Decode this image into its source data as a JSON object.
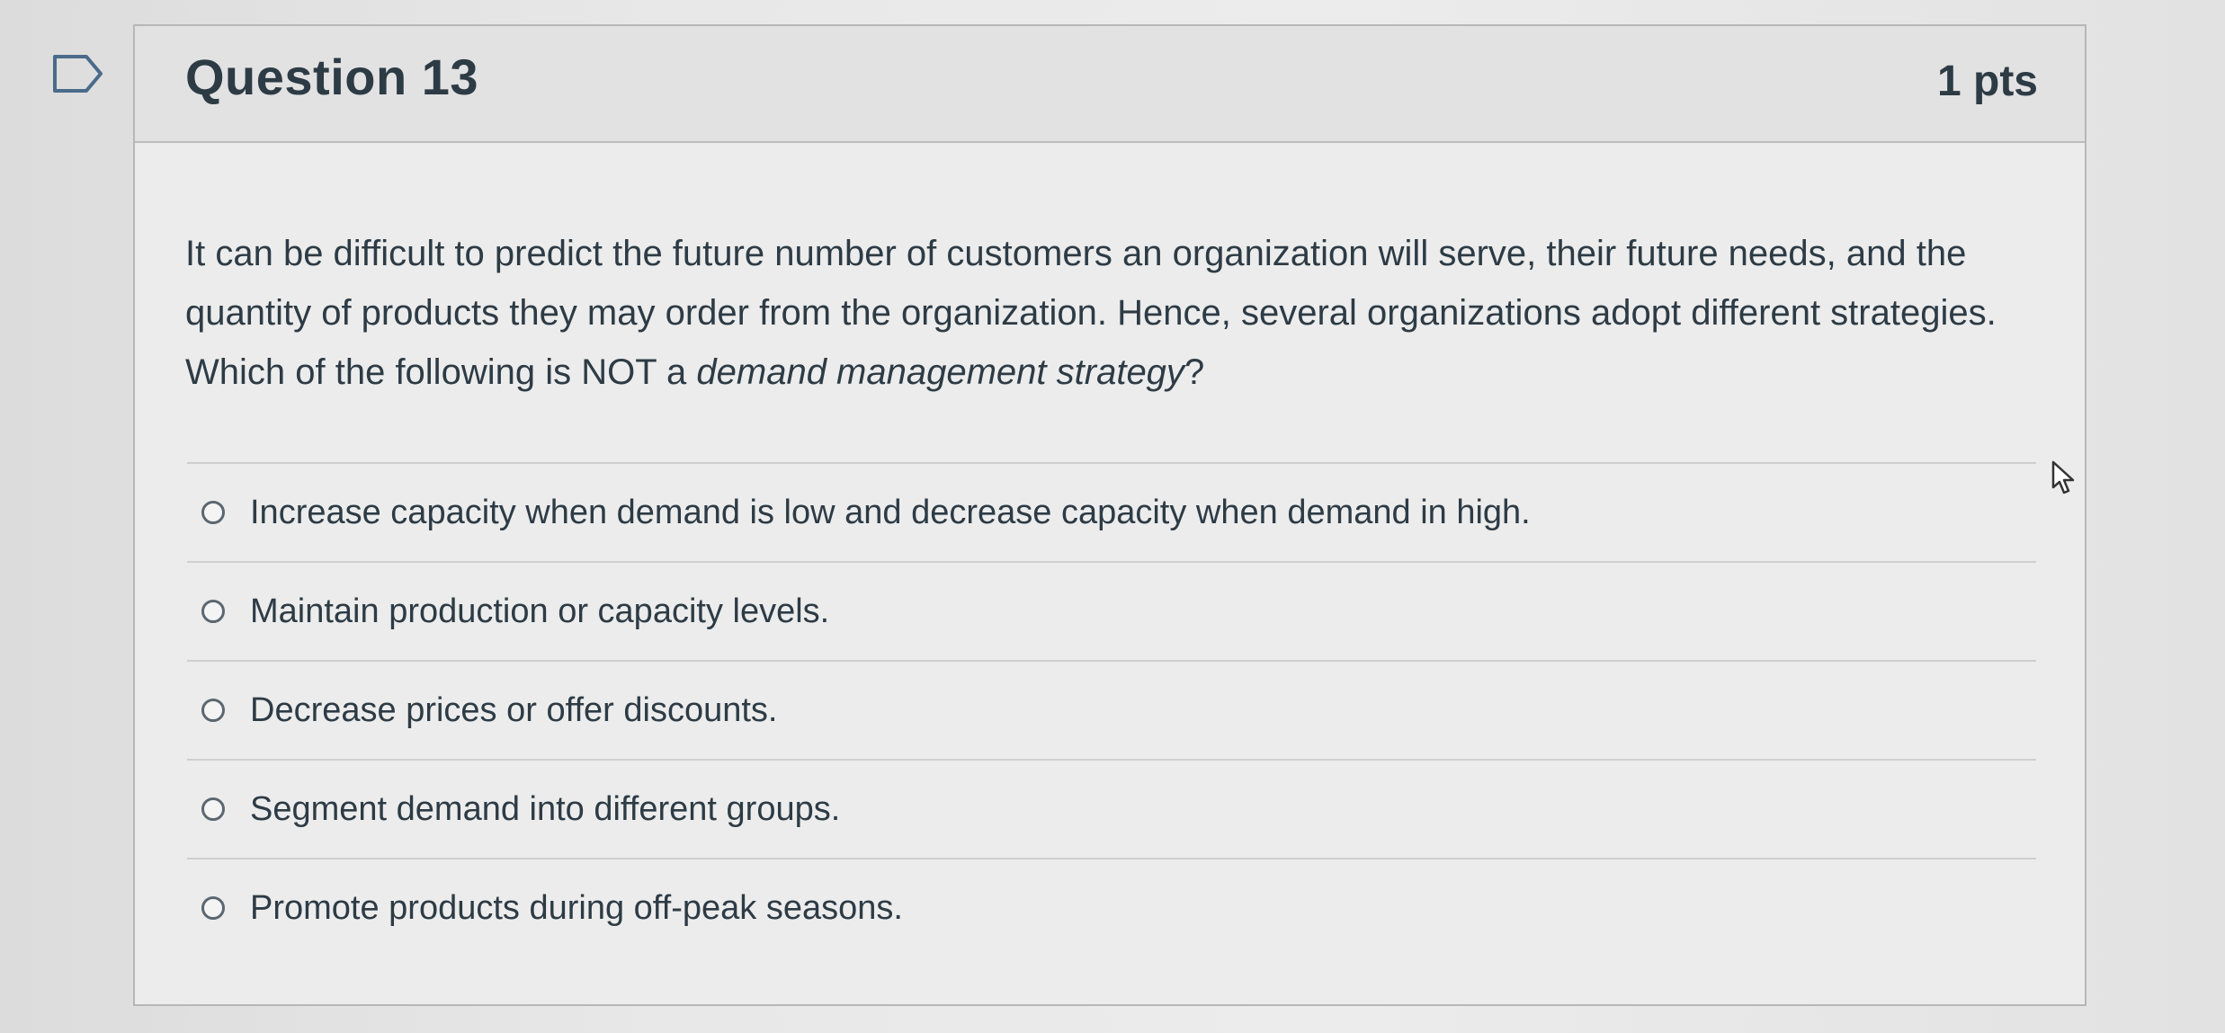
{
  "question": {
    "title": "Question 13",
    "points": "1 pts",
    "text_part1": "It can be difficult to predict the future number of customers an organization will serve, their future needs, and the quantity of products they may order from the organization. Hence, several organizations adopt different strategies. Which of the following is NOT a ",
    "text_emphasis": "demand management strategy",
    "text_part2": "?"
  },
  "answers": [
    {
      "label": "Increase capacity when demand is low and decrease capacity when demand in high.",
      "selected": false
    },
    {
      "label": "Maintain production or capacity levels.",
      "selected": false
    },
    {
      "label": "Decrease prices or offer discounts.",
      "selected": false
    },
    {
      "label": "Segment demand into different groups.",
      "selected": false
    },
    {
      "label": "Promote products during off-peak seasons.",
      "selected": false
    }
  ],
  "icons": {
    "flag": "flag-question-icon",
    "cursor": "mouse-pointer-icon"
  },
  "colors": {
    "text": "#2d3b45",
    "card_border": "#b7b7b7",
    "header_bg": "#e2e2e2"
  }
}
